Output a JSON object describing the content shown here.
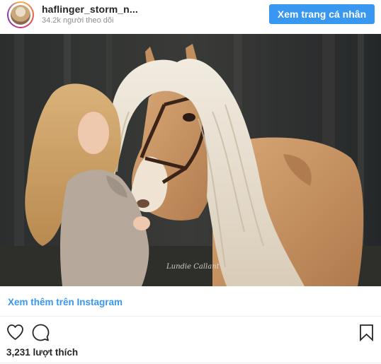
{
  "header": {
    "username": "haflinger_storm_n...",
    "followers": "34.2k người theo dõi",
    "profile_button": "Xem trang cá nhân"
  },
  "post": {
    "view_more_link": "Xem thêm trên Instagram",
    "likes": "3,231 lượt thích",
    "photo_watermark": "Lundie Callant"
  },
  "icons": {
    "like": "heart-icon",
    "comment": "comment-icon",
    "save": "bookmark-icon"
  },
  "colors": {
    "accent": "#3897f0",
    "text": "#262626",
    "muted": "#8e8e8e"
  }
}
